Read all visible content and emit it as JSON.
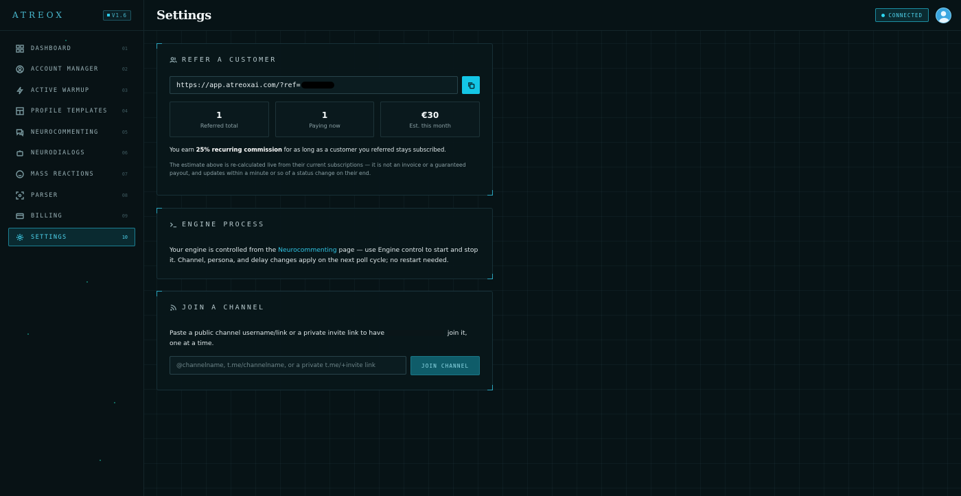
{
  "brand": {
    "name": "ATREOX",
    "version": "V1.6"
  },
  "sidebar": {
    "items": [
      {
        "label": "DASHBOARD",
        "num": "01",
        "icon": "grid-icon",
        "active": false
      },
      {
        "label": "ACCOUNT MANAGER",
        "num": "02",
        "icon": "user-circle-icon",
        "active": false
      },
      {
        "label": "ACTIVE WARMUP",
        "num": "03",
        "icon": "bolt-icon",
        "active": false
      },
      {
        "label": "PROFILE TEMPLATES",
        "num": "04",
        "icon": "layout-icon",
        "active": false
      },
      {
        "label": "NEUROCOMMENTING",
        "num": "05",
        "icon": "chat-icon",
        "active": false
      },
      {
        "label": "NEURODIALOGS",
        "num": "06",
        "icon": "bot-icon",
        "active": false
      },
      {
        "label": "MASS REACTIONS",
        "num": "07",
        "icon": "smile-icon",
        "active": false
      },
      {
        "label": "PARSER",
        "num": "08",
        "icon": "scan-icon",
        "active": false
      },
      {
        "label": "BILLING",
        "num": "09",
        "icon": "card-icon",
        "active": false
      },
      {
        "label": "SETTINGS",
        "num": "10",
        "icon": "gear-icon",
        "active": true
      }
    ]
  },
  "header": {
    "title": "Settings",
    "status": "CONNECTED"
  },
  "refer": {
    "title": "REFER A CUSTOMER",
    "link": "https://app.atreoxai.com/?ref=",
    "stats": [
      {
        "value": "1",
        "label": "Referred total"
      },
      {
        "value": "1",
        "label": "Paying now"
      },
      {
        "value": "€30",
        "label": "Est. this month"
      }
    ],
    "earn_prefix": "You earn ",
    "earn_bold": "25% recurring commission",
    "earn_suffix": " for as long as a customer you referred stays subscribed.",
    "note": "The estimate above is re-calculated live from their current subscriptions — it is not an invoice or a guaranteed payout, and updates within a minute or so of a status change on their end."
  },
  "engine": {
    "title": "ENGINE PROCESS",
    "text_prefix": "Your engine is controlled from the ",
    "link": "Neurocommenting",
    "text_suffix": " page — use Engine control to start and stop it. Channel, persona, and delay changes apply on the next poll cycle; no restart needed."
  },
  "join": {
    "title": "JOIN A CHANNEL",
    "text_prefix": "Paste a public channel username/link or a private invite link to have ",
    "text_suffix": " join it, one at a time.",
    "placeholder": "@channelname, t.me/channelname, or a private t.me/+invite link",
    "button": "JOIN CHANNEL"
  }
}
